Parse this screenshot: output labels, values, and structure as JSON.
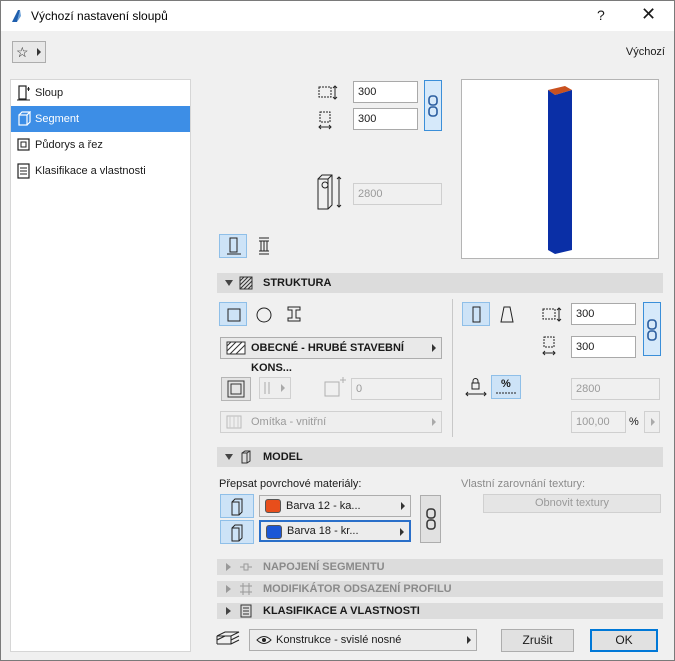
{
  "window": {
    "title": "Výchozí nastavení sloupů",
    "help_label": "?",
    "close_label": "✕"
  },
  "toolbar": {
    "favorites_label": "☆",
    "default_label": "Výchozí"
  },
  "sidebar": {
    "items": [
      {
        "label": "Sloup",
        "icon": "column-icon"
      },
      {
        "label": "Segment",
        "icon": "segment-icon",
        "selected": true
      },
      {
        "label": "Půdorys a řez",
        "icon": "floorplan-icon"
      },
      {
        "label": "Klasifikace a vlastnosti",
        "icon": "classification-icon"
      }
    ]
  },
  "dimensions": {
    "width": "300",
    "depth": "300",
    "height": "2800"
  },
  "preview": {
    "column_color": "#0a2fa6",
    "top_color": "#c9511f"
  },
  "structure": {
    "header": "STRUKTURA",
    "material": "OBECNÉ - HRUBÉ STAVEBNÍ KONS...",
    "core_value": "0",
    "finish": "Omítka - vnitřní",
    "right_width": "300",
    "right_depth": "300",
    "right_height": "2800",
    "percent_value": "100,00",
    "percent_unit": "%",
    "percent_toggle": "%"
  },
  "model": {
    "header": "MODEL",
    "override_label": "Přepsat povrchové materiály:",
    "texture_label": "Vlastní zarovnání textury:",
    "reset_texture_label": "Obnovit textury",
    "materials": [
      {
        "label": "Barva 12 - ka...",
        "color": "#e84e1b"
      },
      {
        "label": "Barva 18 - kr...",
        "color": "#1a56d6"
      }
    ]
  },
  "sections": {
    "segment_connection": "NAPOJENÍ SEGMENTU",
    "profile_modifier": "MODIFIKÁTOR ODSAZENÍ PROFILU",
    "classification": "KLASIFIKACE A VLASTNOSTI"
  },
  "footer": {
    "layer": "Konstrukce - svislé nosné",
    "cancel_label": "Zrušit",
    "ok_label": "OK"
  }
}
